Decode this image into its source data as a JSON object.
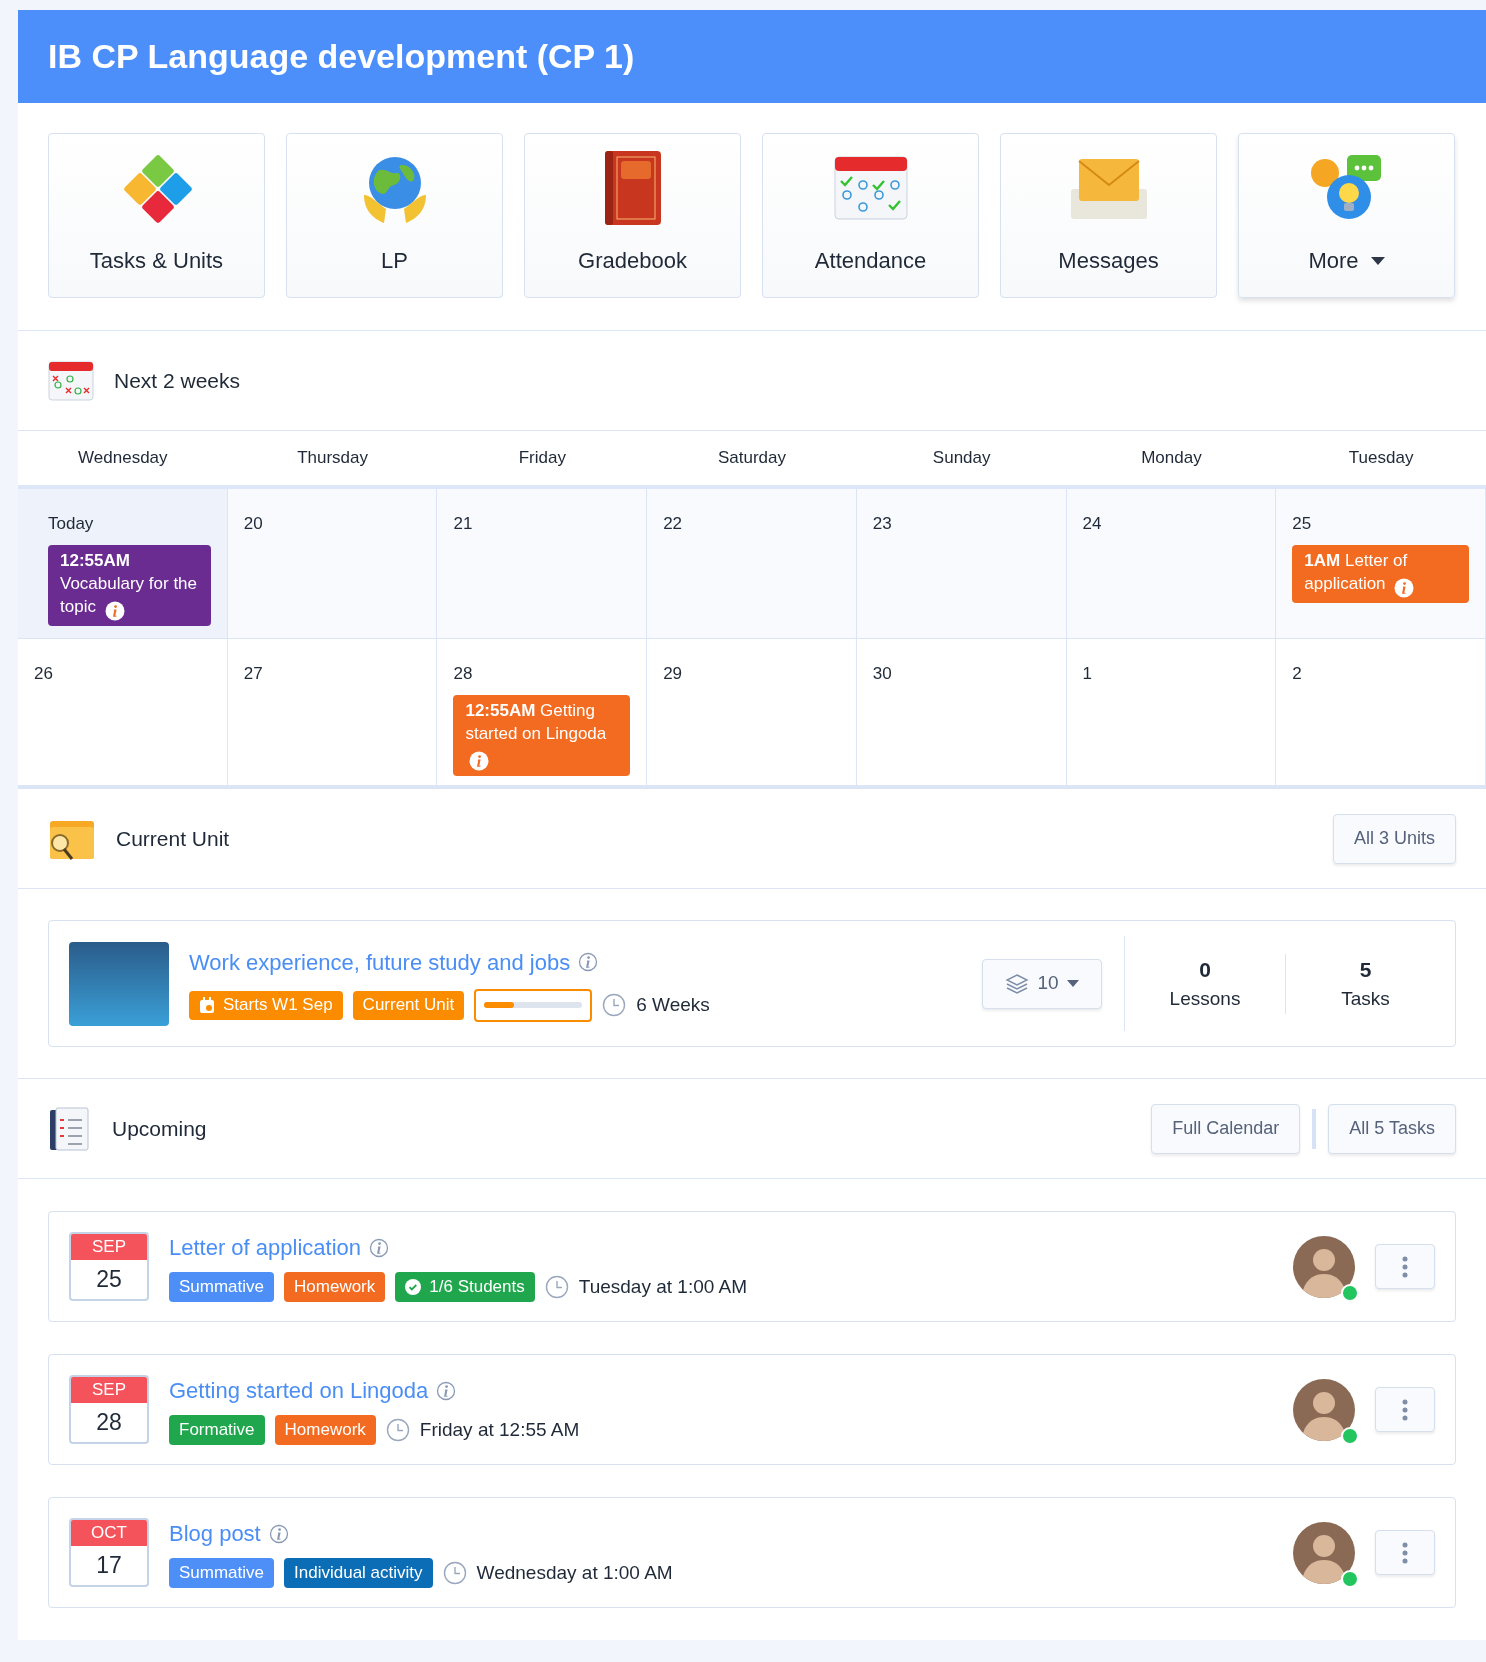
{
  "header": {
    "title": "IB CP Language development (CP 1)"
  },
  "apps": [
    {
      "label": "Tasks & Units",
      "kind": "puzzle",
      "dropdown": false
    },
    {
      "label": "LP",
      "kind": "globe",
      "dropdown": false
    },
    {
      "label": "Gradebook",
      "kind": "book",
      "dropdown": false
    },
    {
      "label": "Attendance",
      "kind": "attendance",
      "dropdown": false
    },
    {
      "label": "Messages",
      "kind": "envelope",
      "dropdown": false
    },
    {
      "label": "More",
      "kind": "bubbles",
      "dropdown": true
    }
  ],
  "calendar": {
    "title": "Next 2 weeks",
    "weekdays": [
      "Wednesday",
      "Thursday",
      "Friday",
      "Saturday",
      "Sunday",
      "Monday",
      "Tuesday"
    ],
    "weeks": [
      [
        {
          "label": "Today",
          "today": true,
          "events": [
            {
              "time": "12:55AM",
              "title": "Vocabulary for the topic",
              "color": "#6a2c91"
            }
          ]
        },
        {
          "label": "20",
          "today": false
        },
        {
          "label": "21",
          "today": false
        },
        {
          "label": "22",
          "today": false
        },
        {
          "label": "23",
          "today": false
        },
        {
          "label": "24",
          "today": false
        },
        {
          "label": "25",
          "today": false,
          "events": [
            {
              "time": "1AM",
              "title": "Letter of application",
              "color": "#f26b21"
            }
          ]
        }
      ],
      [
        {
          "label": "26",
          "today": false
        },
        {
          "label": "27",
          "today": false
        },
        {
          "label": "28",
          "today": false,
          "events": [
            {
              "time": "12:55AM",
              "title": "Getting started on Lingoda",
              "color": "#f26b21"
            }
          ]
        },
        {
          "label": "29",
          "today": false
        },
        {
          "label": "30",
          "today": false
        },
        {
          "label": "1",
          "today": false
        },
        {
          "label": "2",
          "today": false
        }
      ]
    ]
  },
  "current_unit": {
    "title": "Current Unit",
    "all_button": "All 3 Units",
    "unit": {
      "title": "Work experience, future study and jobs",
      "tags": [
        {
          "text": "Starts W1 Sep",
          "kind": "calendar"
        },
        {
          "text": "Current Unit",
          "kind": "plain"
        }
      ],
      "level": 0.3,
      "duration": "6 Weeks",
      "layers": "10",
      "stats": [
        {
          "value": "0",
          "label": "Lessons"
        },
        {
          "value": "5",
          "label": "Tasks"
        }
      ]
    }
  },
  "upcoming": {
    "title": "Upcoming",
    "buttons": [
      "Full Calendar",
      "All 5 Tasks"
    ],
    "tasks": [
      {
        "month": "SEP",
        "day": "25",
        "title": "Letter of application",
        "tags": [
          {
            "text": "Summative",
            "color": "#4d8ff7",
            "kind": "plain"
          },
          {
            "text": "Homework",
            "color": "#f26b21",
            "kind": "plain"
          },
          {
            "text": "1/6 Students",
            "color": "#20a74d",
            "kind": "check"
          }
        ],
        "due": "Tuesday at 1:00 AM",
        "online": true
      },
      {
        "month": "SEP",
        "day": "28",
        "title": "Getting started on Lingoda",
        "tags": [
          {
            "text": "Formative",
            "color": "#20a74d",
            "kind": "plain"
          },
          {
            "text": "Homework",
            "color": "#f26b21",
            "kind": "plain"
          }
        ],
        "due": "Friday at 12:55 AM",
        "online": true
      },
      {
        "month": "OCT",
        "day": "17",
        "title": "Blog post",
        "tags": [
          {
            "text": "Summative",
            "color": "#4d8ff7",
            "kind": "plain"
          },
          {
            "text": "Individual activity",
            "color": "#0b6db5",
            "kind": "plain"
          }
        ],
        "due": "Wednesday at 1:00 AM",
        "online": true
      }
    ]
  }
}
